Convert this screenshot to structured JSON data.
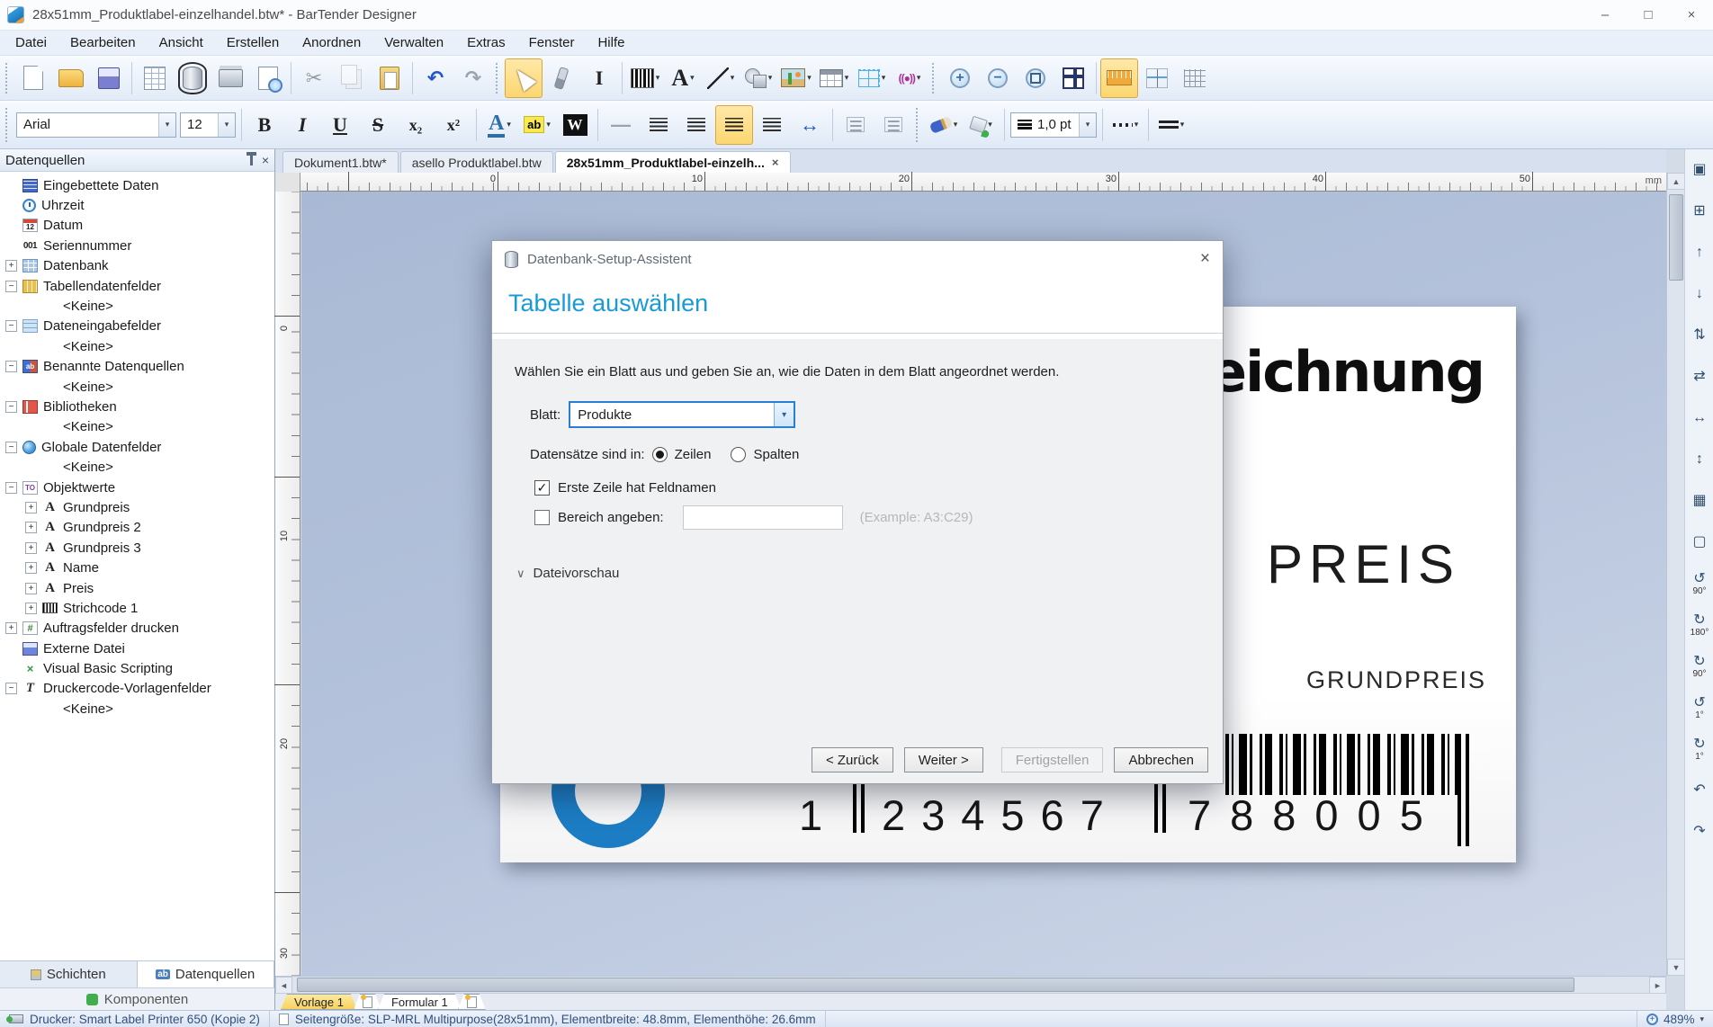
{
  "window": {
    "title": "28x51mm_Produktlabel-einzelhandel.btw* - BarTender Designer"
  },
  "icons": {
    "minimize": "–",
    "maximize": "□",
    "close": "×",
    "undo": "↶",
    "redo": "↷",
    "cut": "✂",
    "ibeam": "I",
    "text_tool": "A",
    "rfid": "((●))",
    "bold": "B",
    "italic": "I",
    "underline": "U",
    "strike": "S",
    "subscript": "x₂",
    "superscript": "x²",
    "font_color": "A",
    "highlight": "ab",
    "wordart": "W",
    "dash": "—",
    "fit_width": "↔",
    "zoom_in": "+",
    "zoom_out": "−",
    "dropdown": "▾",
    "scroll_up": "▲",
    "scroll_down": "▼",
    "scroll_left": "◄",
    "scroll_right": "►",
    "expander_chevron": "∨",
    "check": "✓"
  },
  "menubar": [
    "Datei",
    "Bearbeiten",
    "Ansicht",
    "Erstellen",
    "Anordnen",
    "Verwalten",
    "Extras",
    "Fenster",
    "Hilfe"
  ],
  "toolbar1": [
    {
      "c": "grip"
    },
    {
      "n": "new-document-icon",
      "ic": "i-newdoc"
    },
    {
      "n": "open-icon",
      "ic": "i-folder"
    },
    {
      "n": "save-icon",
      "ic": "i-floppy"
    },
    {
      "c": "sep"
    },
    {
      "n": "page-setup-icon",
      "ic": "i-pagegrid"
    },
    {
      "n": "database-setup-icon",
      "ic": "i-db",
      "c": "framed"
    },
    {
      "n": "print-icon",
      "ic": "i-printer"
    },
    {
      "n": "print-preview-icon",
      "ic": "i-preview"
    },
    {
      "c": "sep"
    },
    {
      "n": "cut-icon",
      "g": "✂",
      "ic": "gly",
      "c": "dis"
    },
    {
      "n": "copy-icon",
      "ic": "i-copy",
      "c": "dis"
    },
    {
      "n": "paste-icon",
      "ic": "i-paste"
    },
    {
      "c": "sep"
    },
    {
      "n": "undo-icon",
      "g": "↶",
      "ic": "gly blue"
    },
    {
      "n": "redo-icon",
      "g": "↷",
      "ic": "gly gray"
    },
    {
      "c": "grip"
    },
    {
      "n": "select-tool-icon",
      "ic": "i-cursor",
      "c": "act"
    },
    {
      "n": "format-painter-icon",
      "ic": "i-painter"
    },
    {
      "n": "ibeam-tool-icon",
      "g": "I",
      "ic": "gly serif"
    },
    {
      "c": "sep"
    },
    {
      "n": "barcode-tool-icon",
      "ic": "i-barcode",
      "dd": "▾"
    },
    {
      "n": "text-tool-icon",
      "g": "A",
      "ic": "gly serif big",
      "dd": "▾"
    },
    {
      "n": "line-tool-icon",
      "ic": "i-line",
      "dd": "▾"
    },
    {
      "n": "shape-tool-icon",
      "ic": "i-shape",
      "dd": "▾"
    },
    {
      "n": "image-tool-icon",
      "ic": "i-image",
      "dd": "▾"
    },
    {
      "n": "table-tool-icon",
      "ic": "i-table",
      "dd": "▾"
    },
    {
      "n": "layout-grid-tool-icon",
      "ic": "i-layout",
      "dd": "▾"
    },
    {
      "n": "rfid-tool-icon",
      "g": "((●))",
      "ic": "i-rfid",
      "dd": "▾"
    },
    {
      "c": "grip"
    },
    {
      "n": "zoom-in-icon",
      "g": "+",
      "ic": "i-zoomin"
    },
    {
      "n": "zoom-out-icon",
      "g": "−",
      "ic": "i-zoomout"
    },
    {
      "n": "zoom-selection-icon",
      "ic": "i-zoomsel"
    },
    {
      "n": "fit-window-icon",
      "ic": "i-fit"
    },
    {
      "c": "sep"
    },
    {
      "n": "ruler-toggle-icon",
      "ic": "i-ruler",
      "c": "act"
    },
    {
      "n": "snap-icon",
      "ic": "i-snap"
    },
    {
      "n": "grid-toggle-icon",
      "ic": "i-grid"
    }
  ],
  "toolbar2": {
    "font": "Arial",
    "size": "12",
    "line_weight": "1,0 pt"
  },
  "doc_tabs": [
    {
      "label": "Dokument1.btw*"
    },
    {
      "label": "asello Produktlabel.btw"
    },
    {
      "label": "28x51mm_Produktlabel-einzelh...",
      "cls": "active",
      "close": "×"
    }
  ],
  "ruler": {
    "h": [
      "0",
      "10",
      "20",
      "30",
      "40",
      "50"
    ],
    "v": [
      "0",
      "10",
      "20",
      "30"
    ],
    "unit": "mm"
  },
  "panel": {
    "title": "Datenquellen",
    "tree": [
      {
        "exp": "",
        "ic": "ti-embed",
        "icn": "embedded-data-icon",
        "ig": "",
        "label": "Eingebettete Daten"
      },
      {
        "exp": "",
        "ic": "ti-clock",
        "icn": "time-icon",
        "ig": "",
        "label": "Uhrzeit"
      },
      {
        "exp": "",
        "ic": "ti-date",
        "icn": "date-icon",
        "ig": "12",
        "label": "Datum"
      },
      {
        "exp": "",
        "ic": "ti-serial",
        "icn": "serial-number-icon",
        "ig": "001",
        "label": "Seriennummer"
      },
      {
        "exp": "+",
        "ic": "ti-db",
        "icn": "database-icon",
        "ig": "",
        "label": "Datenbank"
      },
      {
        "exp": "−",
        "ic": "ti-tblf",
        "icn": "table-data-fields-icon",
        "ig": "",
        "label": "Tabellendatenfelder"
      },
      {
        "exp": "",
        "ic": "",
        "icn": "",
        "ig": "",
        "label": "<Keine>",
        "cls": "keine"
      },
      {
        "exp": "−",
        "ic": "ti-inpf",
        "icn": "data-entry-fields-icon",
        "ig": "",
        "label": "Dateneingabefelder"
      },
      {
        "exp": "",
        "ic": "",
        "icn": "",
        "ig": "",
        "label": "<Keine>",
        "cls": "keine"
      },
      {
        "exp": "−",
        "ic": "ti-named",
        "icn": "named-data-sources-icon",
        "ig": "ab",
        "label": "Benannte Datenquellen"
      },
      {
        "exp": "",
        "ic": "",
        "icn": "",
        "ig": "",
        "label": "<Keine>",
        "cls": "keine"
      },
      {
        "exp": "−",
        "ic": "ti-lib",
        "icn": "libraries-icon",
        "ig": "",
        "label": "Bibliotheken"
      },
      {
        "exp": "",
        "ic": "",
        "icn": "",
        "ig": "",
        "label": "<Keine>",
        "cls": "keine"
      },
      {
        "exp": "−",
        "ic": "ti-globe",
        "icn": "global-data-fields-icon",
        "ig": "",
        "label": "Globale Datenfelder"
      },
      {
        "exp": "",
        "ic": "",
        "icn": "",
        "ig": "",
        "label": "<Keine>",
        "cls": "keine"
      },
      {
        "exp": "−",
        "ic": "ti-obj",
        "icn": "object-values-icon",
        "ig": "TO",
        "label": "Objektwerte"
      },
      {
        "exp": "+",
        "ic": "ti-A",
        "icn": "text-object-icon",
        "ig": "A",
        "label": "Grundpreis",
        "cls": "lvl2"
      },
      {
        "exp": "+",
        "ic": "ti-A",
        "icn": "text-object-icon",
        "ig": "A",
        "label": "Grundpreis 2",
        "cls": "lvl2"
      },
      {
        "exp": "+",
        "ic": "ti-A",
        "icn": "text-object-icon",
        "ig": "A",
        "label": "Grundpreis 3",
        "cls": "lvl2"
      },
      {
        "exp": "+",
        "ic": "ti-A",
        "icn": "text-object-icon",
        "ig": "A",
        "label": "Name",
        "cls": "lvl2"
      },
      {
        "exp": "+",
        "ic": "ti-A",
        "icn": "text-object-icon",
        "ig": "A",
        "label": "Preis",
        "cls": "lvl2"
      },
      {
        "exp": "+",
        "ic": "ti-bar",
        "icn": "barcode-object-icon",
        "ig": "",
        "label": "Strichcode 1",
        "cls": "lvl2"
      },
      {
        "exp": "+",
        "ic": "ti-order",
        "icn": "print-job-fields-icon",
        "ig": "#",
        "label": "Auftragsfelder drucken"
      },
      {
        "exp": "",
        "ic": "ti-ext",
        "icn": "external-file-icon",
        "ig": "",
        "label": "Externe Datei"
      },
      {
        "exp": "",
        "ic": "ti-vbs",
        "icn": "vbs-icon",
        "ig": "×",
        "label": "Visual Basic Scripting"
      },
      {
        "exp": "−",
        "ic": "ti-T",
        "icn": "printer-code-template-icon",
        "ig": "T",
        "label": "Druckercode-Vorlagenfelder"
      },
      {
        "exp": "",
        "ic": "",
        "icn": "",
        "ig": "",
        "label": "<Keine>",
        "cls": "keine"
      }
    ],
    "tab_layers": "Schichten",
    "tab_datasources": "Datenquellen",
    "tab_components": "Komponenten"
  },
  "label_design": {
    "headline": "eichnung",
    "price_word": "PREIS",
    "base_price_word": "GRUNDPREIS",
    "barcode_digits_1": "1",
    "barcode_digits_2": "234567",
    "barcode_digits_3": "788005"
  },
  "dialog": {
    "title": "Datenbank-Setup-Assistent",
    "heading": "Tabelle auswählen",
    "description": "Wählen Sie ein Blatt aus und geben Sie an, wie die Daten in dem Blatt angeordnet werden.",
    "sheet_label": "Blatt:",
    "sheet_value": "Produkte",
    "records_label": "Datensätze sind in:",
    "radio_rows": "Zeilen",
    "radio_cols": "Spalten",
    "check_header": "Erste Zeile hat Feldnamen",
    "check_range": "Bereich angeben:",
    "range_hint": "(Example: A3:C29)",
    "preview_expander": "Dateivorschau",
    "back": "< Zurück",
    "next": "Weiter >",
    "finish": "Fertigstellen",
    "cancel": "Abbrechen"
  },
  "page_tabs": {
    "template": "Vorlage 1",
    "form": "Formular 1"
  },
  "right_toolbar": [
    {
      "n": "insert-object-icon",
      "g": "▣",
      "lbl": ""
    },
    {
      "n": "snap-grid-icon",
      "g": "⊞",
      "lbl": ""
    },
    {
      "n": "align-top-icon",
      "g": "↑",
      "lbl": ""
    },
    {
      "n": "align-bottom-icon",
      "g": "↓",
      "lbl": ""
    },
    {
      "n": "distribute-vertical-icon",
      "g": "⇅",
      "lbl": ""
    },
    {
      "n": "distribute-horizontal-icon",
      "g": "⇄",
      "lbl": ""
    },
    {
      "n": "center-horizontal-icon",
      "g": "↔",
      "lbl": ""
    },
    {
      "n": "center-vertical-icon",
      "g": "↕",
      "lbl": ""
    },
    {
      "n": "group-icon",
      "g": "▦",
      "lbl": ""
    },
    {
      "n": "ungroup-icon",
      "g": "▢",
      "lbl": ""
    },
    {
      "n": "rotate-90-ccw-icon",
      "g": "↺",
      "lbl": "90°"
    },
    {
      "n": "rotate-180-icon",
      "g": "↻",
      "lbl": "180°"
    },
    {
      "n": "rotate-90-cw-icon",
      "g": "↻",
      "lbl": "90°"
    },
    {
      "n": "rotate-1-ccw-icon",
      "g": "↺",
      "lbl": "1°"
    },
    {
      "n": "rotate-1-cw-icon",
      "g": "↻",
      "lbl": "1°"
    },
    {
      "n": "flip-horizontal-icon",
      "g": "↶",
      "lbl": ""
    },
    {
      "n": "flip-vertical-icon",
      "g": "↷",
      "lbl": ""
    }
  ],
  "statusbar": {
    "printer": "Drucker: Smart Label Printer 650 (Kopie 2)",
    "page_info": "Seitengröße: SLP-MRL Multipurpose(28x51mm), Elementbreite: 48.8mm, Elementhöhe: 26.6mm",
    "zoom": "489%"
  }
}
